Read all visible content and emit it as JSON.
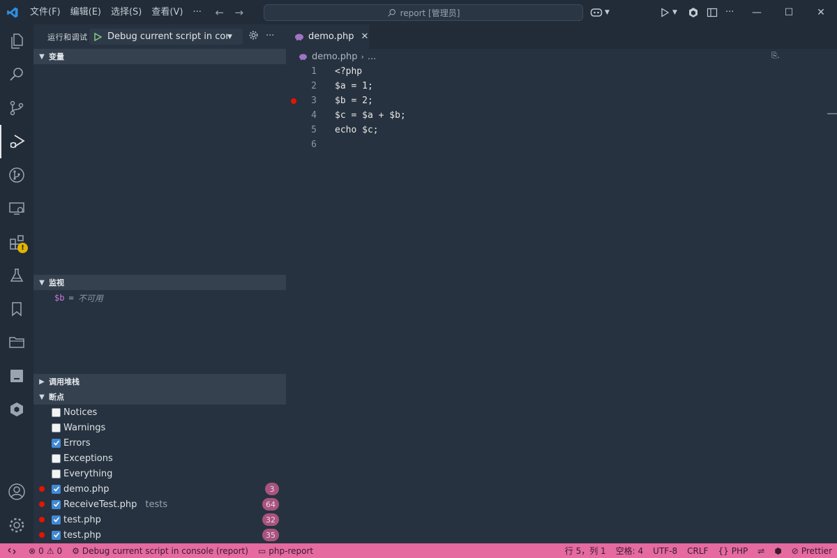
{
  "titlebar": {
    "menu": [
      "文件(F)",
      "编辑(E)",
      "选择(S)",
      "查看(V)"
    ],
    "more": "···",
    "command_center": "report [管理员]"
  },
  "sidebar": {
    "title": "运行和调试",
    "debug_config": "Debug current script in console",
    "sections": {
      "variables": "变量",
      "watch": "监视",
      "call_stack": "调用堆栈",
      "breakpoints": "断点"
    },
    "watch_item": {
      "name": "$b",
      "eq": "=",
      "value": "不可用"
    },
    "exception_breakpoints": [
      {
        "label": "Notices",
        "checked": false
      },
      {
        "label": "Warnings",
        "checked": false
      },
      {
        "label": "Errors",
        "checked": true
      },
      {
        "label": "Exceptions",
        "checked": false
      },
      {
        "label": "Everything",
        "checked": false
      }
    ],
    "file_breakpoints": [
      {
        "file": "demo.php",
        "folder": "",
        "line": "3"
      },
      {
        "file": "ReceiveTest.php",
        "folder": "tests",
        "line": "64"
      },
      {
        "file": "test.php",
        "folder": "",
        "line": "32"
      },
      {
        "file": "test.php",
        "folder": "",
        "line": "35"
      }
    ]
  },
  "editor": {
    "tab": "demo.php",
    "breadcrumb": {
      "file": "demo.php",
      "rest": "..."
    },
    "lines": [
      {
        "n": "1",
        "text": "<?php",
        "bp": false
      },
      {
        "n": "2",
        "text": "$a = 1;",
        "bp": false
      },
      {
        "n": "3",
        "text": "$b = 2;",
        "bp": true
      },
      {
        "n": "4",
        "text": "$c = $a + $b;",
        "bp": false
      },
      {
        "n": "5",
        "text": "echo $c;",
        "bp": false
      },
      {
        "n": "6",
        "text": "",
        "bp": false
      }
    ]
  },
  "statusbar": {
    "errors": "0",
    "warnings": "0",
    "debug_label": "Debug current script in console (report)",
    "folder": "php-report",
    "position": "行 5，列 1",
    "spaces": "空格: 4",
    "encoding": "UTF-8",
    "eol": "CRLF",
    "language": "PHP",
    "prettier": "Prettier"
  },
  "colors": {
    "accent": "#e46aa0",
    "breakpoint": "#e51400",
    "vscode_blue": "#2f8fe0",
    "badge": "#a7547f"
  }
}
